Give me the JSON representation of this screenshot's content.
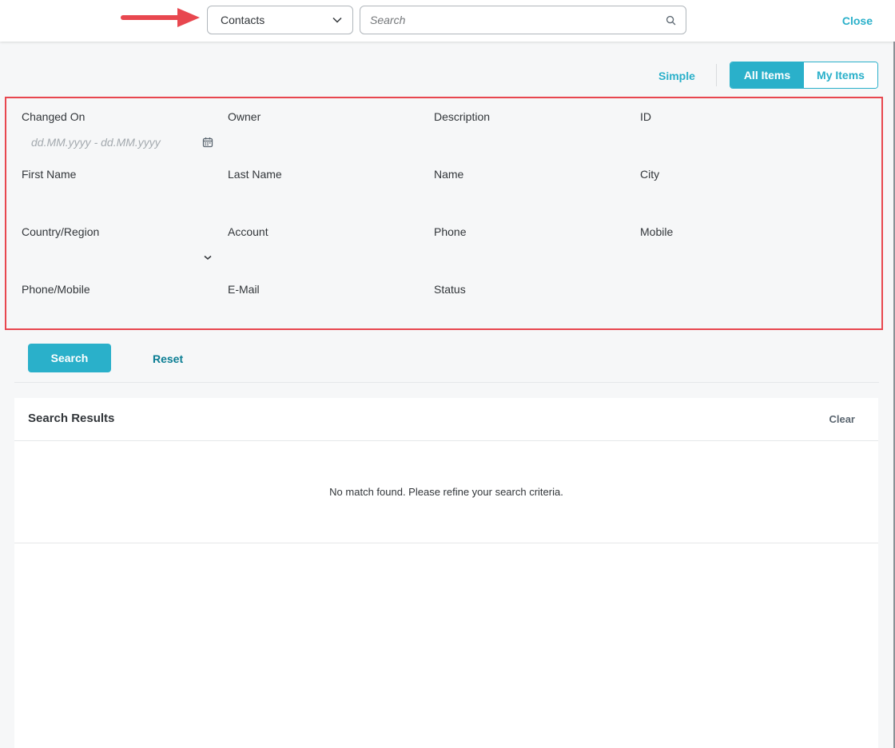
{
  "topbar": {
    "object_selector": {
      "value": "Contacts"
    },
    "search": {
      "placeholder": "Search"
    },
    "close_label": "Close"
  },
  "modes": {
    "simple_label": "Simple",
    "all_items_label": "All Items",
    "my_items_label": "My Items"
  },
  "criteria": {
    "changed_on": {
      "label": "Changed On",
      "placeholder": "dd.MM.yyyy - dd.MM.yyyy"
    },
    "owner": {
      "label": "Owner"
    },
    "description": {
      "label": "Description"
    },
    "id": {
      "label": "ID"
    },
    "first_name": {
      "label": "First Name"
    },
    "last_name": {
      "label": "Last Name"
    },
    "name": {
      "label": "Name"
    },
    "city": {
      "label": "City"
    },
    "country_region": {
      "label": "Country/Region"
    },
    "account": {
      "label": "Account"
    },
    "phone": {
      "label": "Phone"
    },
    "mobile": {
      "label": "Mobile"
    },
    "phone_mobile": {
      "label": "Phone/Mobile"
    },
    "email": {
      "label": "E-Mail"
    },
    "status": {
      "label": "Status"
    }
  },
  "actions": {
    "search_label": "Search",
    "reset_label": "Reset"
  },
  "results": {
    "title": "Search Results",
    "clear_label": "Clear",
    "empty_message": "No match found. Please refine your search criteria."
  },
  "colors": {
    "accent": "#2ab0ca",
    "highlight_border": "#e8474f",
    "annotation_arrow": "#e8474f"
  },
  "icons": {
    "object_selector": "chevron-down-icon",
    "search": "search-icon",
    "date": "calendar-icon",
    "country": "chevron-down-icon",
    "annotation": "arrow-right-icon"
  }
}
